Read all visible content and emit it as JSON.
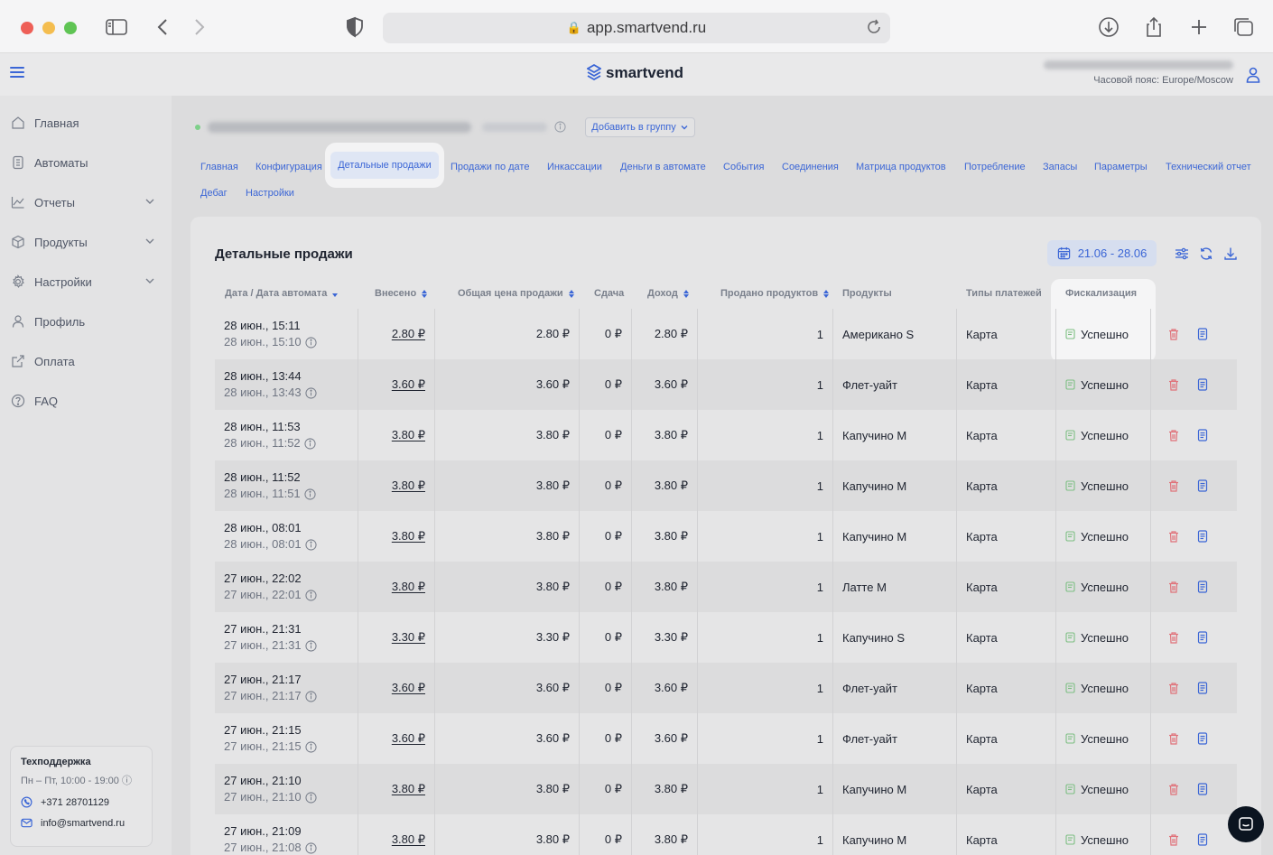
{
  "browser": {
    "url": "app.smartvend.ru"
  },
  "header": {
    "logo_text": "smartvend",
    "timezone": "Часовой пояс: Europe/Moscow"
  },
  "sidebar": {
    "items": [
      {
        "label": "Главная",
        "icon": "home-icon",
        "expandable": false
      },
      {
        "label": "Автоматы",
        "icon": "machine-icon",
        "expandable": false
      },
      {
        "label": "Отчеты",
        "icon": "chart-icon",
        "expandable": true
      },
      {
        "label": "Продукты",
        "icon": "box-icon",
        "expandable": true
      },
      {
        "label": "Настройки",
        "icon": "gear-icon",
        "expandable": true
      },
      {
        "label": "Профиль",
        "icon": "user-icon",
        "expandable": false
      },
      {
        "label": "Оплата",
        "icon": "external-link-icon",
        "expandable": false
      },
      {
        "label": "FAQ",
        "icon": "question-icon",
        "expandable": false
      }
    ],
    "support": {
      "title": "Техподдержка",
      "hours": "Пн – Пт, 10:00 - 19:00",
      "phone": "+371 28701129",
      "email": "info@smartvend.ru"
    }
  },
  "machine": {
    "add_group_label": "Добавить в группу"
  },
  "tabs": [
    "Главная",
    "Конфигурация",
    "Детальные продажи",
    "Продажи по дате",
    "Инкассации",
    "Деньги в автомате",
    "События",
    "Соединения",
    "Матрица продуктов",
    "Потребление",
    "Запасы",
    "Параметры",
    "Технический отчет",
    "Дебаг",
    "Настройки"
  ],
  "active_tab": "Детальные продажи",
  "report": {
    "title": "Детальные продажи",
    "date_range": "21.06 - 28.06",
    "columns": [
      "Дата / Дата автомата",
      "Внесено",
      "Общая цена продажи",
      "Сдача",
      "Доход",
      "Продано продуктов",
      "Продукты",
      "Типы платежей",
      "Фискализация"
    ],
    "rows": [
      {
        "date": "28 июн., 15:11",
        "machine_date": "28 июн., 15:10",
        "paid": "2.80 ₽",
        "total": "2.80 ₽",
        "change": "0 ₽",
        "income": "2.80 ₽",
        "qty": "1",
        "product": "Американо S",
        "payment": "Карта",
        "fiscal": "Успешно"
      },
      {
        "date": "28 июн., 13:44",
        "machine_date": "28 июн., 13:43",
        "paid": "3.60 ₽",
        "total": "3.60 ₽",
        "change": "0 ₽",
        "income": "3.60 ₽",
        "qty": "1",
        "product": "Флет-уайт",
        "payment": "Карта",
        "fiscal": "Успешно"
      },
      {
        "date": "28 июн., 11:53",
        "machine_date": "28 июн., 11:52",
        "paid": "3.80 ₽",
        "total": "3.80 ₽",
        "change": "0 ₽",
        "income": "3.80 ₽",
        "qty": "1",
        "product": "Капучино M",
        "payment": "Карта",
        "fiscal": "Успешно"
      },
      {
        "date": "28 июн., 11:52",
        "machine_date": "28 июн., 11:51",
        "paid": "3.80 ₽",
        "total": "3.80 ₽",
        "change": "0 ₽",
        "income": "3.80 ₽",
        "qty": "1",
        "product": "Капучино M",
        "payment": "Карта",
        "fiscal": "Успешно"
      },
      {
        "date": "28 июн., 08:01",
        "machine_date": "28 июн., 08:01",
        "paid": "3.80 ₽",
        "total": "3.80 ₽",
        "change": "0 ₽",
        "income": "3.80 ₽",
        "qty": "1",
        "product": "Капучино M",
        "payment": "Карта",
        "fiscal": "Успешно"
      },
      {
        "date": "27 июн., 22:02",
        "machine_date": "27 июн., 22:01",
        "paid": "3.80 ₽",
        "total": "3.80 ₽",
        "change": "0 ₽",
        "income": "3.80 ₽",
        "qty": "1",
        "product": "Латте M",
        "payment": "Карта",
        "fiscal": "Успешно"
      },
      {
        "date": "27 июн., 21:31",
        "machine_date": "27 июн., 21:31",
        "paid": "3.30 ₽",
        "total": "3.30 ₽",
        "change": "0 ₽",
        "income": "3.30 ₽",
        "qty": "1",
        "product": "Капучино S",
        "payment": "Карта",
        "fiscal": "Успешно"
      },
      {
        "date": "27 июн., 21:17",
        "machine_date": "27 июн., 21:17",
        "paid": "3.60 ₽",
        "total": "3.60 ₽",
        "change": "0 ₽",
        "income": "3.60 ₽",
        "qty": "1",
        "product": "Флет-уайт",
        "payment": "Карта",
        "fiscal": "Успешно"
      },
      {
        "date": "27 июн., 21:15",
        "machine_date": "27 июн., 21:15",
        "paid": "3.60 ₽",
        "total": "3.60 ₽",
        "change": "0 ₽",
        "income": "3.60 ₽",
        "qty": "1",
        "product": "Флет-уайт",
        "payment": "Карта",
        "fiscal": "Успешно"
      },
      {
        "date": "27 июн., 21:10",
        "machine_date": "27 июн., 21:10",
        "paid": "3.80 ₽",
        "total": "3.80 ₽",
        "change": "0 ₽",
        "income": "3.80 ₽",
        "qty": "1",
        "product": "Капучино M",
        "payment": "Карта",
        "fiscal": "Успешно"
      },
      {
        "date": "27 июн., 21:09",
        "machine_date": "27 июн., 21:08",
        "paid": "3.80 ₽",
        "total": "3.80 ₽",
        "change": "0 ₽",
        "income": "3.80 ₽",
        "qty": "1",
        "product": "Капучино M",
        "payment": "Карта",
        "fiscal": "Успешно"
      }
    ]
  },
  "colors": {
    "accent": "#3b66d6",
    "success": "#7dbf83",
    "danger": "#e0727a"
  }
}
